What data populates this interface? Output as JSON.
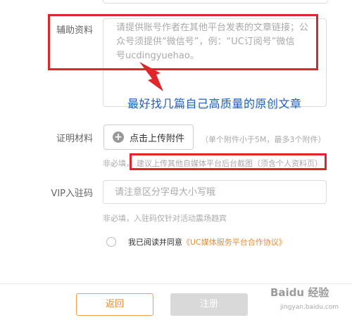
{
  "form": {
    "supplementary": {
      "label": "辅助资料",
      "placeholder_line1": "请提供账号作者在其他平台发表的文章链接；公",
      "placeholder_line2": "众号须提供“微信号”，例：“UC订阅号”微信",
      "placeholder_line3": "号ucdingyuehao。"
    },
    "proof": {
      "label": "证明材料",
      "upload_label": "点击上传附件",
      "limit_hint": "（单个附件小于5M，最多3个附件）",
      "optional_hint_prefix": "非必填，",
      "optional_hint_main": "建议上传其他自媒体平台后台截图（须含个人资料页）"
    },
    "vip": {
      "label": "VIP入驻码",
      "placeholder": "请注意区分字母大小写哦",
      "hint": "非必填，入驻码仅针对活动震场趋宾"
    },
    "agreement": {
      "text": "我已阅读并同意",
      "link": "《UC媒体服务平台合作协议》"
    },
    "buttons": {
      "back": "返回",
      "register": "注册"
    }
  },
  "annotation": {
    "text": "最好找几篇自己高质量的原创文章"
  },
  "watermark": {
    "brand": "Baidu 经验",
    "url": "jingyan.baidu.com"
  },
  "colors": {
    "accent": "#f28c28",
    "annotation_red": "#e0262b",
    "annotation_blue": "#1f5fbf"
  }
}
